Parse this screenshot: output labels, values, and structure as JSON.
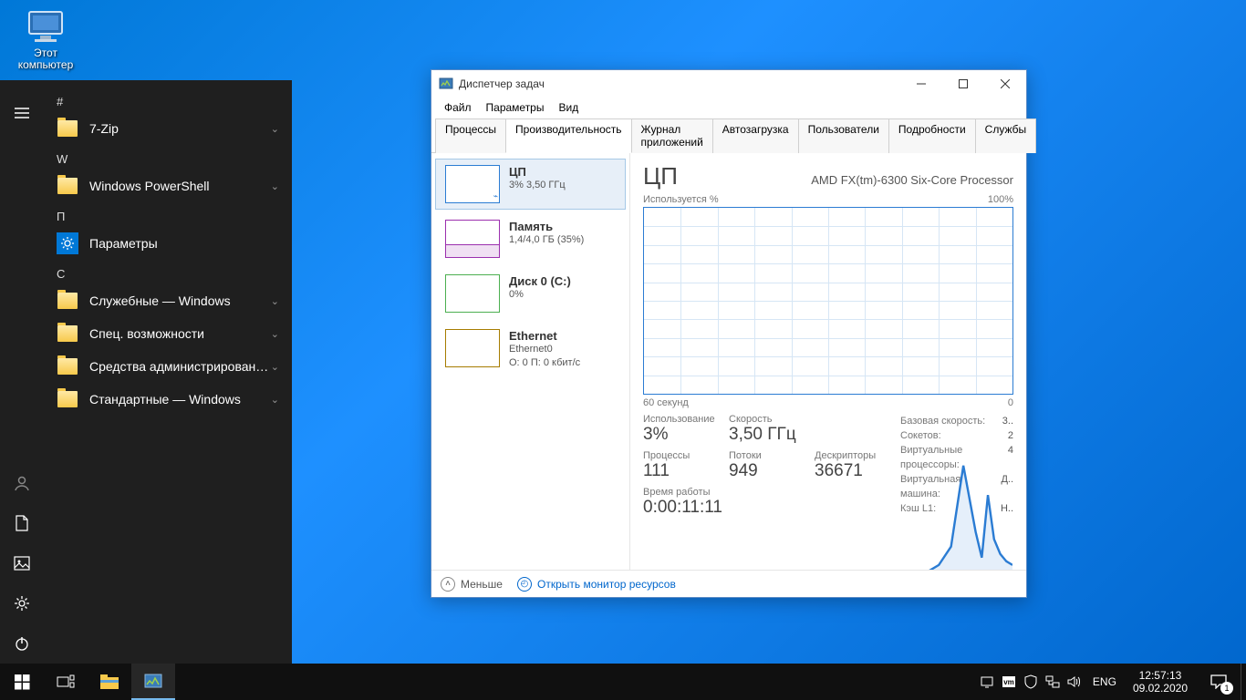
{
  "desktop": {
    "this_pc": "Этот\nкомпьютер"
  },
  "start": {
    "groups": [
      {
        "letter": "#",
        "items": [
          {
            "label": "7-Zip",
            "icon": "folder",
            "expand": true
          }
        ]
      },
      {
        "letter": "W",
        "items": [
          {
            "label": "Windows PowerShell",
            "icon": "folder",
            "expand": true
          }
        ]
      },
      {
        "letter": "П",
        "items": [
          {
            "label": "Параметры",
            "icon": "gear",
            "expand": false
          }
        ]
      },
      {
        "letter": "С",
        "items": [
          {
            "label": "Служебные — Windows",
            "icon": "folder",
            "expand": true
          },
          {
            "label": "Спец. возможности",
            "icon": "folder",
            "expand": true
          },
          {
            "label": "Средства администрирования...",
            "icon": "folder",
            "expand": true
          },
          {
            "label": "Стандартные — Windows",
            "icon": "folder",
            "expand": true
          }
        ]
      }
    ]
  },
  "tm": {
    "title": "Диспетчер задач",
    "menu": [
      "Файл",
      "Параметры",
      "Вид"
    ],
    "tabs": [
      "Процессы",
      "Производительность",
      "Журнал приложений",
      "Автозагрузка",
      "Пользователи",
      "Подробности",
      "Службы"
    ],
    "active_tab": 1,
    "side": [
      {
        "title": "ЦП",
        "sub": "3%  3,50 ГГц",
        "kind": "cpu",
        "active": true
      },
      {
        "title": "Память",
        "sub": "1,4/4,0 ГБ (35%)",
        "kind": "mem"
      },
      {
        "title": "Диск 0 (C:)",
        "sub": "0%",
        "kind": "disk"
      },
      {
        "title": "Ethernet",
        "sub": "Ethernet0",
        "sub2": "О: 0  П: 0 кбит/с",
        "kind": "net"
      }
    ],
    "main": {
      "heading": "ЦП",
      "model": "AMD FX(tm)-6300 Six-Core Processor",
      "y_label_left": "Используется %",
      "y_label_right": "100%",
      "x_label_left": "60 секунд",
      "x_label_right": "0",
      "stats_row1": [
        {
          "label": "Использование",
          "value": "3%"
        },
        {
          "label": "Скорость",
          "value": "3,50 ГГц"
        }
      ],
      "stats_row2": [
        {
          "label": "Процессы",
          "value": "111"
        },
        {
          "label": "Потоки",
          "value": "949"
        },
        {
          "label": "Дескрипторы",
          "value": "36671"
        }
      ],
      "uptime_label": "Время работы",
      "uptime_value": "0:00:11:11",
      "right_stats": [
        {
          "label": "Базовая скорость:",
          "value": "3.."
        },
        {
          "label": "Сокетов:",
          "value": "2"
        },
        {
          "label": "Виртуальные процессоры:",
          "value": "4"
        },
        {
          "label": "Виртуальная машина:",
          "value": "Д.."
        },
        {
          "label": "Кэш L1:",
          "value": "Н.."
        }
      ]
    },
    "footer": {
      "less": "Меньше",
      "resmon": "Открыть монитор ресурсов"
    }
  },
  "taskbar": {
    "lang": "ENG",
    "time": "12:57:13",
    "date": "09.02.2020",
    "notif_count": "1"
  },
  "chart_data": {
    "type": "line",
    "title": "Используется %",
    "xlabel": "60 секунд → 0",
    "ylabel": "%",
    "ylim": [
      0,
      100
    ],
    "x": [
      60,
      55,
      50,
      45,
      40,
      35,
      30,
      25,
      20,
      15,
      12,
      10,
      8,
      6,
      5,
      4,
      3,
      2,
      1,
      0
    ],
    "values": [
      0,
      0,
      0,
      0,
      0,
      0,
      0,
      0,
      0,
      0,
      3,
      8,
      30,
      12,
      5,
      22,
      10,
      6,
      4,
      3
    ]
  }
}
